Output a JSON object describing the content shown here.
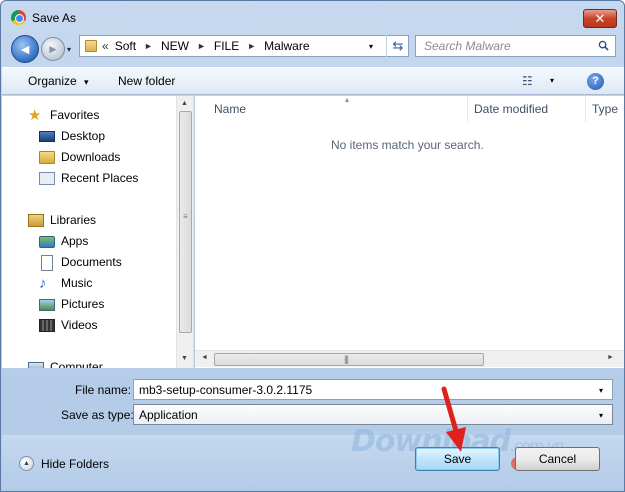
{
  "window": {
    "title": "Save As",
    "close_glyph": "✕"
  },
  "nav": {
    "back_glyph": "◄",
    "forward_glyph": "►",
    "history_glyph": "▾",
    "breadcrumb_lead": "«",
    "breadcrumb": [
      "Soft",
      "NEW",
      "FILE",
      "Malware"
    ],
    "breadcrumb_sep": "►",
    "dropdown_glyph": "▾",
    "refresh_glyph": "⇆",
    "search_placeholder": "Search Malware"
  },
  "toolbar": {
    "organize_label": "Organize",
    "organize_drop": "▾",
    "new_folder_label": "New folder",
    "view_glyph": "☷",
    "view_drop": "▾",
    "help_glyph": "?"
  },
  "sidebar": {
    "favorites": {
      "label": "Favorites",
      "items": [
        "Desktop",
        "Downloads",
        "Recent Places"
      ]
    },
    "libraries": {
      "label": "Libraries",
      "items": [
        "Apps",
        "Documents",
        "Music",
        "Pictures",
        "Videos"
      ]
    },
    "computer": {
      "label": "Computer"
    },
    "scroll_up": "▲",
    "scroll_down": "▼",
    "grip": "≡"
  },
  "filelist": {
    "columns": [
      "Name",
      "Date modified",
      "Type"
    ],
    "sort_glyph": "▴",
    "empty_message": "No items match your search.",
    "scroll_left": "◄",
    "scroll_right": "►",
    "grip": "|||"
  },
  "form": {
    "file_name_label": "File name:",
    "file_name_underline": "n",
    "file_name_value": "mb3-setup-consumer-3.0.2.1175",
    "save_type_label": "Save as type:",
    "save_type_underline": "t",
    "save_type_value": "Application",
    "dropdown_glyph": "▾"
  },
  "footer": {
    "hide_folders_label": "Hide Folders",
    "hide_glyph": "▲",
    "save_label": "Save",
    "cancel_label": "Cancel"
  },
  "watermark": {
    "text": "Download",
    "suffix": ".com.vn"
  },
  "colors": {
    "accent": "#3c7fb1",
    "arrow": "#e0201b",
    "dots": [
      "#e74c3c",
      "#f1c40f",
      "#2ecc71",
      "#3498db",
      "#e74c3c"
    ]
  }
}
